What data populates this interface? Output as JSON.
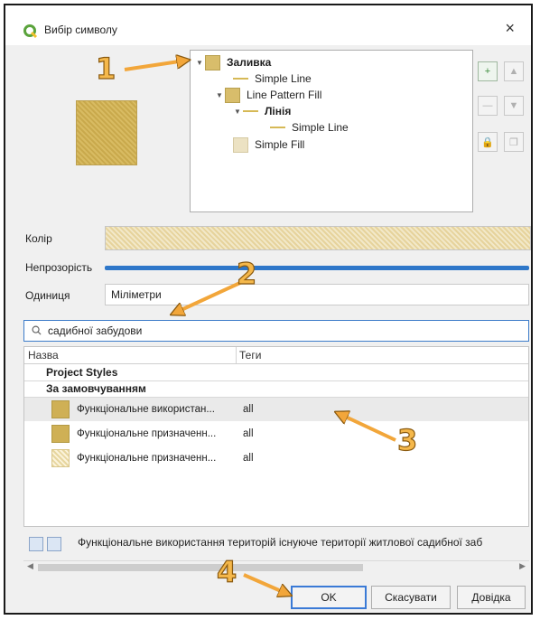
{
  "window": {
    "title": "Вибір символу",
    "close_glyph": "×"
  },
  "tree": {
    "items": [
      {
        "label": "Заливка"
      },
      {
        "label": "Simple Line"
      },
      {
        "label": "Line Pattern Fill"
      },
      {
        "label": "Лінія"
      },
      {
        "label": "Simple Line"
      },
      {
        "label": "Simple Fill"
      }
    ]
  },
  "side_buttons": {
    "add": "+",
    "up": "▲",
    "remove": "—",
    "down": "▼",
    "lock": "🔒",
    "duplicate": "❐"
  },
  "fields": {
    "color_label": "Колір",
    "opacity_label": "Непрозорість",
    "unit_label": "Одиниця",
    "unit_value": "Міліметри"
  },
  "search": {
    "value": "садибної забудови"
  },
  "table": {
    "col_name": "Назва",
    "col_tags": "Теги",
    "groups": [
      "Project Styles",
      "За замовчуванням"
    ],
    "rows": [
      {
        "name": "Функціональне використан...",
        "tags": "all"
      },
      {
        "name": "Функціональне призначенн...",
        "tags": "all"
      },
      {
        "name": "Функціональне призначенн...",
        "tags": "all"
      }
    ]
  },
  "description": "Функціональне використання територій існуюче території житлової садибної заб",
  "buttons": {
    "ok": "OK",
    "cancel": "Скасувати",
    "help": "Довідка"
  },
  "annotations": [
    "1",
    "2",
    "3",
    "4"
  ],
  "colors": {
    "accent": "#3a7ad6",
    "symbol_fill": "#d8bd6b",
    "annotation": "#f5b84b"
  }
}
